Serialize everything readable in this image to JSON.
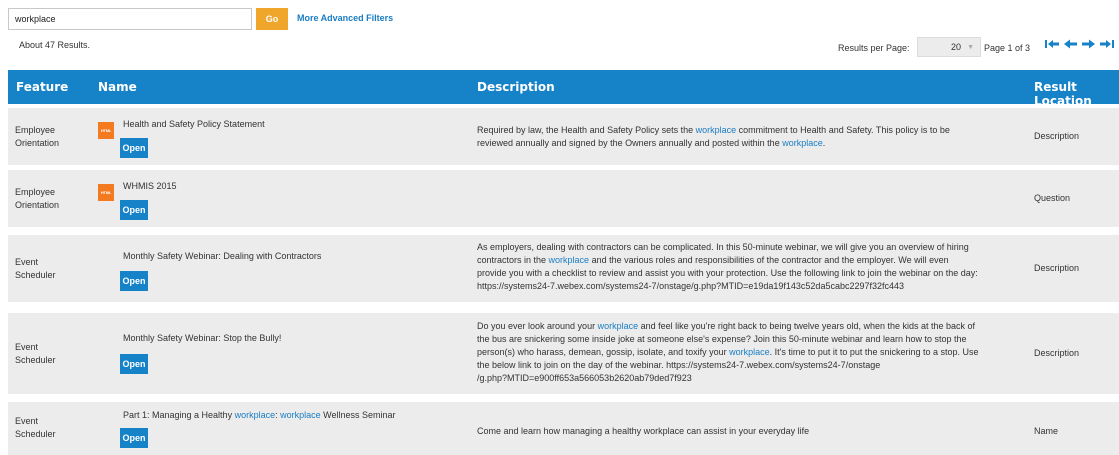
{
  "search": {
    "value": "workplace",
    "go_label": "Go",
    "advanced_label": "More Advanced Filters"
  },
  "results_count": "About 47 Results.",
  "pagination": {
    "rpp_label": "Results per Page:",
    "rpp_value": "20",
    "page_info": "Page 1 of 3"
  },
  "columns": {
    "feature": "Feature",
    "name": "Name",
    "description": "Description",
    "location": "Result Location"
  },
  "open_label": "Open",
  "html_badge": "HTML",
  "rows": [
    {
      "feature_1": "Employee",
      "feature_2": "Orientation",
      "name": "Health and Safety Policy Statement",
      "desc": [
        "Required by law, the Health and Safety Policy sets the ",
        {
          "hl": "workplace"
        },
        " commitment to Health and Safety. This policy is to be",
        {
          "br": true
        },
        "reviewed annually and signed by the Owners annually and posted within the ",
        {
          "hl": "workplace"
        },
        "."
      ],
      "location": "Description"
    },
    {
      "feature_1": "Employee",
      "feature_2": "Orientation",
      "name": "WHMIS 2015",
      "desc": [],
      "location": "Question"
    },
    {
      "feature_1": "Event",
      "feature_2": "Scheduler",
      "name": "Monthly Safety Webinar: Dealing with Contractors",
      "desc": [
        "As employers, dealing with contractors can be complicated. In this 50-minute webinar, we will give you an overview of hiring",
        {
          "br": true
        },
        "contractors in the ",
        {
          "hl": "workplace"
        },
        " and the various roles and responsibilities of the contractor and the employer. We will even",
        {
          "br": true
        },
        "provide you with a checklist to review and assist you with your protection. Use the following link to join the webinar on the day:",
        {
          "br": true
        },
        "https://systems24-7.webex.com/systems24-7/onstage/g.php?MTID=e19da19f143c52da5cabc2297f32fc443"
      ],
      "location": "Description"
    },
    {
      "feature_1": "Event",
      "feature_2": "Scheduler",
      "name": "Monthly Safety Webinar: Stop the Bully!",
      "desc": [
        "Do you ever look around your ",
        {
          "hl": "workplace"
        },
        " and feel like you're right back to being twelve years old, when the kids at the back of",
        {
          "br": true
        },
        "the bus are snickering some inside joke at someone else's expense? Join this 50-minute webinar and learn how to stop the",
        {
          "br": true
        },
        "person(s) who harass, demean, gossip, isolate, and toxify your ",
        {
          "hl": "workplace"
        },
        ". It's time to put it to put the snickering to a stop. Use",
        {
          "br": true
        },
        "the below link to join on the day of the webinar. https://systems24-7.webex.com/systems24-7/onstage",
        {
          "br": true
        },
        "/g.php?MTID=e900ff653a566053b2620ab79ded7f923"
      ],
      "location": "Description"
    },
    {
      "feature_1": "Event",
      "feature_2": "Scheduler",
      "name_parts": [
        "Part 1: Managing a Healthy ",
        {
          "hl": "workplace"
        },
        ": ",
        {
          "hl": "workplace"
        },
        " Wellness Seminar"
      ],
      "desc": [
        "Come and learn how managing a healthy workplace can assist in your everyday life"
      ],
      "location": "Name"
    }
  ],
  "colors": {
    "header_blue": "#1683c9",
    "go_orange": "#f0a52b",
    "link_blue": "#1a7dc4",
    "row_gray": "#ececec",
    "html_badge": "#f47a1f"
  }
}
